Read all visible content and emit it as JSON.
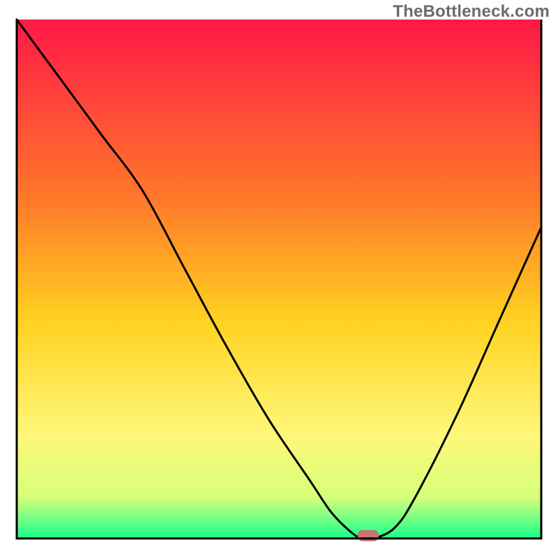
{
  "watermark": "TheBottleneck.com",
  "colors": {
    "gradient_top": "#ff1846",
    "gradient_upper_mid": "#ff7a2a",
    "gradient_mid": "#ffd21f",
    "gradient_lower_mid": "#fff77a",
    "gradient_low": "#d7ff7a",
    "gradient_bottom": "#18ff8c",
    "curve": "#000000",
    "frame": "#000000",
    "marker": "#c97272"
  },
  "chart_data": {
    "type": "line",
    "title": "",
    "xlabel": "",
    "ylabel": "",
    "xlim": [
      0,
      100
    ],
    "ylim": [
      0,
      100
    ],
    "series": [
      {
        "name": "bottleneck-curve",
        "x": [
          0,
          8,
          16,
          24,
          32,
          40,
          48,
          56,
          60,
          64,
          66,
          68,
          72,
          76,
          84,
          92,
          100
        ],
        "values": [
          100,
          89,
          78,
          67,
          52,
          37,
          23,
          11,
          5,
          1,
          0,
          0,
          2,
          8,
          24,
          42,
          60
        ]
      }
    ],
    "marker": {
      "x": 67,
      "y": 0
    },
    "annotations": [],
    "legend": false,
    "grid": false
  }
}
